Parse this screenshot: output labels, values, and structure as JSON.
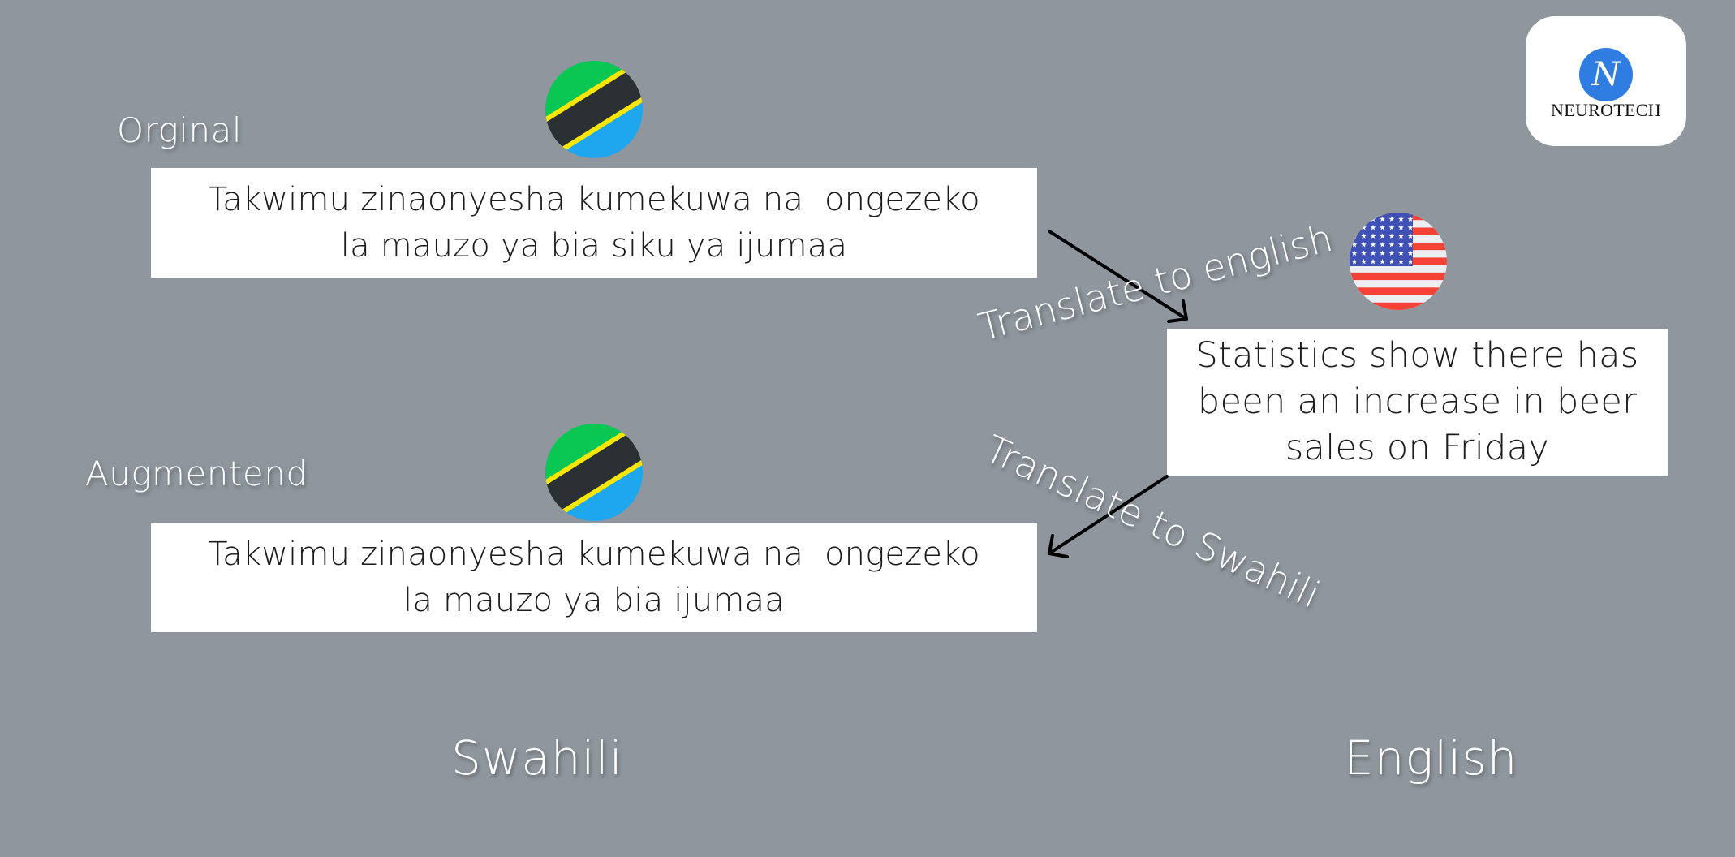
{
  "logo": {
    "icon_letter": "N",
    "brand_name": "NEUROTECH",
    "icon_color": "#2f7de1"
  },
  "original": {
    "label": "Orginal",
    "flag": "tanzania-flag-icon",
    "lines": [
      "Takwimu zinaonyesha kumekuwa na  ongezeko",
      "la mauzo ya bia siku ya ijumaa"
    ]
  },
  "augmented": {
    "label": "Augmentend",
    "flag": "tanzania-flag-icon",
    "lines": [
      "Takwimu zinaonyesha kumekuwa na  ongezeko",
      "la mauzo ya bia ijumaa"
    ]
  },
  "translation": {
    "flag": "usa-flag-icon",
    "lines": [
      "Statistics show there has",
      "been an increase in beer",
      "sales on Friday"
    ]
  },
  "arrows": {
    "to_english_label": "Translate to english",
    "to_swahili_label": "Translate to Swahili"
  },
  "languages": {
    "left": "Swahili",
    "right": "English"
  },
  "colors": {
    "background": "#8f969e",
    "box": "#ffffff",
    "text": "#1c1c1c",
    "label": "#ffffff",
    "tz_green": "#0ac754",
    "tz_yellow": "#fce600",
    "tz_black": "#2b3035",
    "tz_blue": "#1ea6ef",
    "us_blue": "#3f51b5",
    "us_red": "#f44336",
    "us_white": "#eceff1"
  }
}
